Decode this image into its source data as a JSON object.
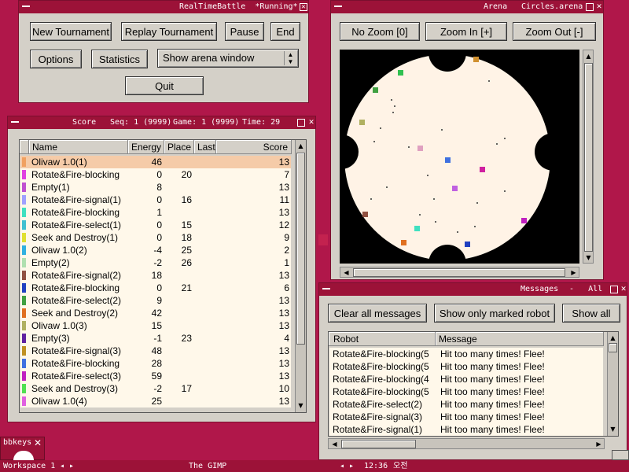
{
  "control": {
    "title": "RealTimeBattle  *Running*",
    "new_tournament": "New Tournament",
    "replay_tournament": "Replay Tournament",
    "pause": "Pause",
    "end": "End",
    "options": "Options",
    "statistics": "Statistics",
    "arena_select_value": "Show arena window",
    "quit": "Quit"
  },
  "score": {
    "title_label": "Score",
    "seq": "Seq: 1 (9999)",
    "game": "Game: 1 (9999)",
    "time": "Time: 29",
    "columns": [
      "Name",
      "Energy",
      "Place",
      "Last",
      "Score"
    ],
    "rows": [
      {
        "name": "Olivaw 1.0(1)",
        "energy": "46",
        "place": "",
        "last": "",
        "score": "13",
        "color": "#f0a060"
      },
      {
        "name": "Rotate&Fire-blocking",
        "energy": "0",
        "place": "20",
        "last": "",
        "score": "7",
        "color": "#e040e0"
      },
      {
        "name": "Empty(1)",
        "energy": "8",
        "place": "",
        "last": "",
        "score": "13",
        "color": "#c050d0"
      },
      {
        "name": "Rotate&Fire-signal(1)",
        "energy": "0",
        "place": "16",
        "last": "",
        "score": "11",
        "color": "#a0a0ff"
      },
      {
        "name": "Rotate&Fire-blocking",
        "energy": "1",
        "place": "",
        "last": "",
        "score": "13",
        "color": "#40e0c0"
      },
      {
        "name": "Rotate&Fire-select(1)",
        "energy": "0",
        "place": "15",
        "last": "",
        "score": "12",
        "color": "#40c0d0"
      },
      {
        "name": "Seek and Destroy(1)",
        "energy": "0",
        "place": "18",
        "last": "",
        "score": "9",
        "color": "#e0e030"
      },
      {
        "name": "Olivaw 1.0(2)",
        "energy": "-4",
        "place": "25",
        "last": "",
        "score": "2",
        "color": "#30b0e0"
      },
      {
        "name": "Empty(2)",
        "energy": "-2",
        "place": "26",
        "last": "",
        "score": "1",
        "color": "#b0e0b0"
      },
      {
        "name": "Rotate&Fire-signal(2)",
        "energy": "18",
        "place": "",
        "last": "",
        "score": "13",
        "color": "#905040"
      },
      {
        "name": "Rotate&Fire-blocking",
        "energy": "0",
        "place": "21",
        "last": "",
        "score": "6",
        "color": "#2040c0"
      },
      {
        "name": "Rotate&Fire-select(2)",
        "energy": "9",
        "place": "",
        "last": "",
        "score": "13",
        "color": "#40a040"
      },
      {
        "name": "Seek and Destroy(2)",
        "energy": "42",
        "place": "",
        "last": "",
        "score": "13",
        "color": "#e07020"
      },
      {
        "name": "Olivaw 1.0(3)",
        "energy": "15",
        "place": "",
        "last": "",
        "score": "13",
        "color": "#b0b060"
      },
      {
        "name": "Empty(3)",
        "energy": "-1",
        "place": "23",
        "last": "",
        "score": "4",
        "color": "#6020a0"
      },
      {
        "name": "Rotate&Fire-signal(3)",
        "energy": "48",
        "place": "",
        "last": "",
        "score": "13",
        "color": "#c09020"
      },
      {
        "name": "Rotate&Fire-blocking",
        "energy": "28",
        "place": "",
        "last": "",
        "score": "13",
        "color": "#4070e0"
      },
      {
        "name": "Rotate&Fire-select(3)",
        "energy": "59",
        "place": "",
        "last": "",
        "score": "13",
        "color": "#c020c0"
      },
      {
        "name": "Seek and Destroy(3)",
        "energy": "-2",
        "place": "17",
        "last": "",
        "score": "10",
        "color": "#50e050"
      },
      {
        "name": "Olivaw 1.0(4)",
        "energy": "25",
        "place": "",
        "last": "",
        "score": "13",
        "color": "#e060e0"
      }
    ]
  },
  "arena": {
    "title_label": "Arena",
    "arena_file": "Circles.arena",
    "no_zoom": "No Zoom [0]",
    "zoom_in": "Zoom In [+]",
    "zoom_out": "Zoom Out [-]"
  },
  "messages": {
    "title_label": "Messages",
    "filter": "-   All",
    "clear_all": "Clear all messages",
    "show_marked": "Show only marked robot",
    "show_all": "Show all",
    "columns": [
      "Robot",
      "Message"
    ],
    "rows": [
      {
        "robot": "Rotate&Fire-blocking(5",
        "message": "Hit too many times! Flee!"
      },
      {
        "robot": "Rotate&Fire-blocking(5",
        "message": "Hit too many times! Flee!"
      },
      {
        "robot": "Rotate&Fire-blocking(4",
        "message": "Hit too many times! Flee!"
      },
      {
        "robot": "Rotate&Fire-blocking(5",
        "message": "Hit too many times! Flee!"
      },
      {
        "robot": "Rotate&Fire-select(2)",
        "message": "Hit too many times! Flee!"
      },
      {
        "robot": "Rotate&Fire-signal(3)",
        "message": "Hit too many times! Flee!"
      },
      {
        "robot": "Rotate&Fire-signal(1)",
        "message": "Hit too many times! Flee!"
      }
    ]
  },
  "bbkeys": {
    "label": "bbkeys"
  },
  "taskbar": {
    "workspace": "Workspace 1",
    "active_task": "The GIMP",
    "clock": "12:36",
    "clock_suffix": "오전"
  },
  "colors": {
    "title_bar": "#9c1238",
    "desktop": "#b0174a",
    "window_bg": "#d4d0c8",
    "arena_floor": "#fff3e6"
  }
}
